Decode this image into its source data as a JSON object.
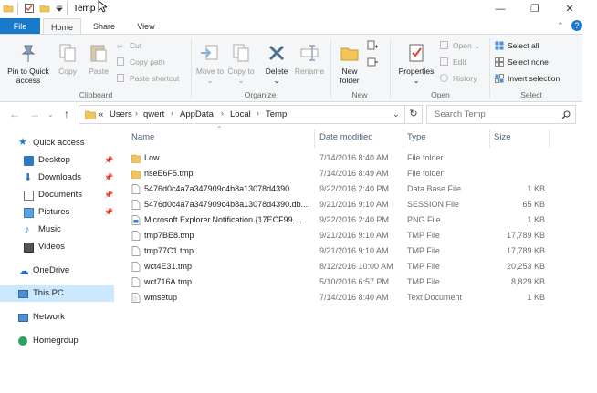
{
  "window": {
    "title": "Temp",
    "min": "—",
    "max": "❐",
    "close": "✕"
  },
  "ribbon_tabs": [
    "File",
    "Home",
    "Share",
    "View"
  ],
  "ribbon": {
    "clipboard": {
      "pin": "Pin to Quick access",
      "copy": "Copy",
      "paste": "Paste",
      "cut": "Cut",
      "copy_path": "Copy path",
      "paste_shortcut": "Paste shortcut",
      "label": "Clipboard"
    },
    "organize": {
      "move_to": "Move to",
      "copy_to": "Copy to",
      "delete": "Delete",
      "rename": "Rename",
      "label": "Organize"
    },
    "new": {
      "new_folder": "New folder",
      "label": "New"
    },
    "open": {
      "properties": "Properties",
      "open": "Open",
      "edit": "Edit",
      "history": "History",
      "label": "Open"
    },
    "select": {
      "select_all": "Select all",
      "select_none": "Select none",
      "invert": "Invert selection",
      "label": "Select"
    }
  },
  "address": {
    "prefix": "«",
    "crumbs": [
      "Users",
      "qwert",
      "AppData",
      "Local",
      "Temp"
    ],
    "search_placeholder": "Search Temp"
  },
  "nav": [
    {
      "label": "Quick access",
      "icon": "star-icon",
      "pinned": false
    },
    {
      "label": "Desktop",
      "icon": "desktop-icon",
      "pinned": true
    },
    {
      "label": "Downloads",
      "icon": "download-icon",
      "pinned": true
    },
    {
      "label": "Documents",
      "icon": "documents-icon",
      "pinned": true
    },
    {
      "label": "Pictures",
      "icon": "pictures-icon",
      "pinned": true
    },
    {
      "label": "Music",
      "icon": "music-icon",
      "pinned": false
    },
    {
      "label": "Videos",
      "icon": "videos-icon",
      "pinned": false
    },
    {
      "label": "OneDrive",
      "icon": "cloud-icon",
      "pinned": false
    },
    {
      "label": "This PC",
      "icon": "computer-icon",
      "pinned": false
    },
    {
      "label": "Network",
      "icon": "network-icon",
      "pinned": false
    },
    {
      "label": "Homegroup",
      "icon": "homegroup-icon",
      "pinned": false
    }
  ],
  "pin_glyph": "📌",
  "columns": {
    "name": "Name",
    "date": "Date modified",
    "type": "Type",
    "size": "Size"
  },
  "files": [
    {
      "name": "Low",
      "date": "7/14/2016 8:40 AM",
      "type": "File folder",
      "size": "",
      "icon": "folder-icon"
    },
    {
      "name": "nseE6F5.tmp",
      "date": "7/14/2016 8:49 AM",
      "type": "File folder",
      "size": "",
      "icon": "folder-icon"
    },
    {
      "name": "5476d0c4a7a347909c4b8a13078d4390",
      "date": "9/22/2016 2:40 PM",
      "type": "Data Base File",
      "size": "1 KB",
      "icon": "file-icon"
    },
    {
      "name": "5476d0c4a7a347909c4b8a13078d4390.db....",
      "date": "9/21/2016 9:10 AM",
      "type": "SESSION File",
      "size": "65 KB",
      "icon": "file-icon"
    },
    {
      "name": "Microsoft.Explorer.Notification.{17ECF99....",
      "date": "9/22/2016 2:40 PM",
      "type": "PNG File",
      "size": "1 KB",
      "icon": "image-file-icon"
    },
    {
      "name": "tmp7BE8.tmp",
      "date": "9/21/2016 9:10 AM",
      "type": "TMP File",
      "size": "17,789 KB",
      "icon": "file-icon"
    },
    {
      "name": "tmp77C1.tmp",
      "date": "9/21/2016 9:10 AM",
      "type": "TMP File",
      "size": "17,789 KB",
      "icon": "file-icon"
    },
    {
      "name": "wct4E31.tmp",
      "date": "8/12/2016 10:00 AM",
      "type": "TMP File",
      "size": "20,253 KB",
      "icon": "file-icon"
    },
    {
      "name": "wct716A.tmp",
      "date": "5/10/2016 6:57 PM",
      "type": "TMP File",
      "size": "8,829 KB",
      "icon": "file-icon"
    },
    {
      "name": "wmsetup",
      "date": "7/14/2016 8:40 AM",
      "type": "Text Document",
      "size": "1 KB",
      "icon": "text-file-icon"
    }
  ]
}
